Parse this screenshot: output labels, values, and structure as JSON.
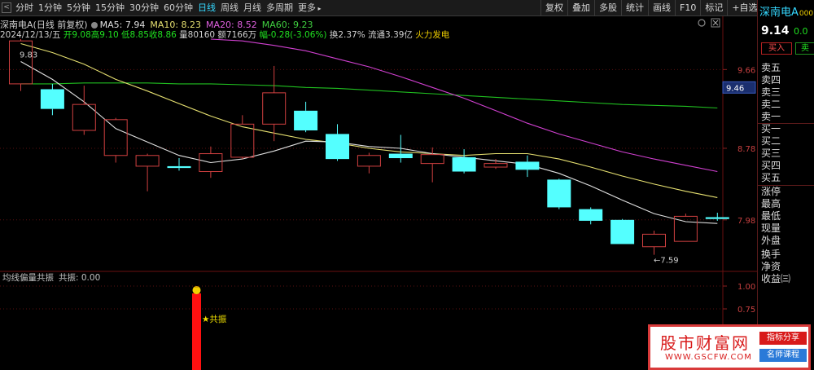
{
  "toolbar": {
    "timeframes": [
      "分时",
      "1分钟",
      "5分钟",
      "15分钟",
      "30分钟",
      "60分钟",
      "日线",
      "周线",
      "月线",
      "多周期",
      "更多"
    ],
    "active_timeframe": "日线",
    "tools": [
      "复权",
      "叠加",
      "多股",
      "统计",
      "画线",
      "F10",
      "标记",
      "+自选",
      "返回"
    ]
  },
  "header": {
    "symbol_title": "深南电A(日线 前复权)",
    "ma5": "MA5: 7.94",
    "ma10": "MA10: 8.23",
    "ma20": "MA20: 8.52",
    "ma60": "MA60: 9.23",
    "date": "2024/12/13/五",
    "open": "开9.08",
    "high": "高9.10",
    "low": "低8.85",
    "close": "收8.86",
    "volume": "量80160",
    "amount": "额7166万",
    "change": "幅-0.28(-3.06%)",
    "turnover": "换2.37%",
    "float_cap": "流通3.39亿",
    "sector": "火力发电"
  },
  "price_axis": {
    "labels": [
      "9.66",
      "8.78",
      "7.98"
    ],
    "current_tag": "9.46"
  },
  "annotations": {
    "high_label": "9.83",
    "low_label": "←7.59"
  },
  "indicator": {
    "title": "均线偏量共振",
    "value_text": "共振: 0.00",
    "axis_labels": [
      "1.00",
      "0.75"
    ],
    "marker_label": "★共振"
  },
  "chart_data": {
    "type": "candlestick",
    "title": "深南电A(日线 前复权)",
    "ylim": [
      7.45,
      10.0
    ],
    "candles": [
      {
        "open": 9.5,
        "close": 9.98,
        "high": 10.0,
        "low": 9.42
      },
      {
        "open": 9.44,
        "close": 9.22,
        "high": 9.5,
        "low": 9.15
      },
      {
        "open": 8.98,
        "close": 9.27,
        "high": 9.48,
        "low": 8.93
      },
      {
        "open": 8.7,
        "close": 9.1,
        "high": 9.12,
        "low": 8.62
      },
      {
        "open": 8.58,
        "close": 8.7,
        "high": 8.72,
        "low": 8.3
      },
      {
        "open": 8.58,
        "close": 8.56,
        "high": 8.67,
        "low": 8.53
      },
      {
        "open": 8.52,
        "close": 8.72,
        "high": 8.8,
        "low": 8.45
      },
      {
        "open": 8.68,
        "close": 9.05,
        "high": 9.15,
        "low": 8.66
      },
      {
        "open": 9.05,
        "close": 9.4,
        "high": 9.7,
        "low": 8.86
      },
      {
        "open": 9.2,
        "close": 8.98,
        "high": 9.3,
        "low": 8.96
      },
      {
        "open": 8.94,
        "close": 8.66,
        "high": 9.05,
        "low": 8.64
      },
      {
        "open": 8.58,
        "close": 8.7,
        "high": 8.73,
        "low": 8.5
      },
      {
        "open": 8.72,
        "close": 8.67,
        "high": 8.93,
        "low": 8.62
      },
      {
        "open": 8.61,
        "close": 8.71,
        "high": 8.79,
        "low": 8.4
      },
      {
        "open": 8.68,
        "close": 8.52,
        "high": 8.77,
        "low": 8.5
      },
      {
        "open": 8.57,
        "close": 8.61,
        "high": 8.66,
        "low": 8.55
      },
      {
        "open": 8.63,
        "close": 8.54,
        "high": 8.7,
        "low": 8.46
      },
      {
        "open": 8.43,
        "close": 8.12,
        "high": 8.44,
        "low": 8.1
      },
      {
        "open": 8.1,
        "close": 7.97,
        "high": 8.12,
        "low": 7.93
      },
      {
        "open": 7.98,
        "close": 7.71,
        "high": 7.99,
        "low": 7.71
      },
      {
        "open": 7.68,
        "close": 7.82,
        "high": 7.86,
        "low": 7.59
      },
      {
        "open": 7.74,
        "close": 8.02,
        "high": 8.05,
        "low": 7.74
      },
      {
        "open": 8.01,
        "close": 7.99,
        "high": 8.06,
        "low": 7.97
      }
    ],
    "ma5": [
      9.75,
      9.55,
      9.3,
      9.0,
      8.85,
      8.7,
      8.62,
      8.66,
      8.75,
      8.86,
      8.85,
      8.8,
      8.78,
      8.72,
      8.68,
      8.64,
      8.6,
      8.5,
      8.36,
      8.2,
      8.05,
      7.96,
      7.94
    ],
    "ma10": [
      9.95,
      9.85,
      9.72,
      9.55,
      9.42,
      9.28,
      9.14,
      9.02,
      8.95,
      8.88,
      8.84,
      8.78,
      8.74,
      8.72,
      8.7,
      8.72,
      8.72,
      8.66,
      8.57,
      8.47,
      8.38,
      8.3,
      8.23
    ],
    "ma20": [
      null,
      null,
      null,
      null,
      null,
      null,
      10.0,
      9.98,
      9.93,
      9.87,
      9.78,
      9.69,
      9.58,
      9.46,
      9.34,
      9.2,
      9.06,
      8.94,
      8.84,
      8.74,
      8.66,
      8.59,
      8.52
    ],
    "ma60": [
      9.5,
      9.5,
      9.51,
      9.51,
      9.51,
      9.5,
      9.5,
      9.49,
      9.48,
      9.46,
      9.45,
      9.43,
      9.41,
      9.39,
      9.37,
      9.35,
      9.33,
      9.31,
      9.29,
      9.27,
      9.26,
      9.25,
      9.23
    ],
    "colors": {
      "up": "#d04040",
      "down": "#54ffff",
      "ma5": "#e0e0e0",
      "ma10": "#e6e070",
      "ma20": "#d040d0",
      "ma60": "#20c020"
    }
  },
  "right_panel": {
    "title": "深南电A",
    "code": "000",
    "price": "9.14",
    "pct": "0.0",
    "buy_label": "买入",
    "sell_label": "卖",
    "orderbook": [
      "卖五",
      "卖四",
      "卖三",
      "卖二",
      "卖一",
      "买一",
      "买二",
      "买三",
      "买四",
      "买五"
    ],
    "stats": [
      "涨停",
      "最高",
      "最低",
      "现量",
      "外盘",
      "换手",
      "净资",
      "收益㈢"
    ]
  },
  "watermark": {
    "name": "股市财富网",
    "url": "WWW.GSCFW.COM",
    "tag1": "指标分享",
    "tag2": "名师课程"
  }
}
